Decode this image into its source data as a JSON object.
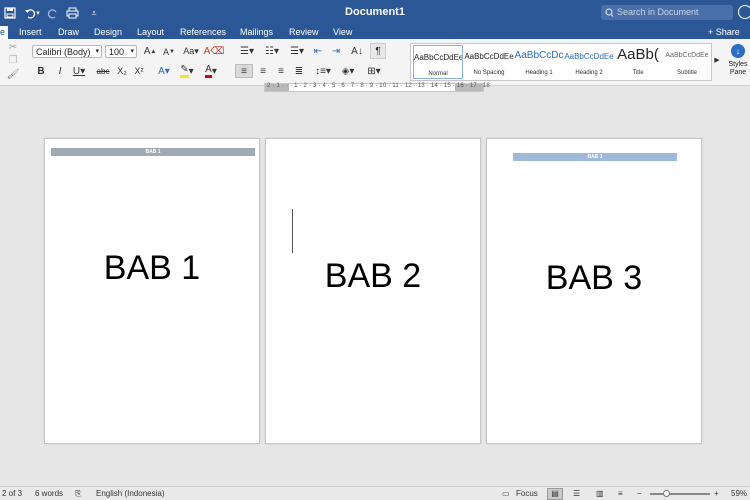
{
  "window": {
    "title": "Document1",
    "search_placeholder": "Search in Document"
  },
  "tabs": [
    {
      "label": "e"
    },
    {
      "label": "Insert"
    },
    {
      "label": "Draw"
    },
    {
      "label": "Design"
    },
    {
      "label": "Layout"
    },
    {
      "label": "References"
    },
    {
      "label": "Mailings"
    },
    {
      "label": "Review"
    },
    {
      "label": "View"
    }
  ],
  "share_label": "+ Share",
  "ribbon": {
    "font_name": "Calibri (Body)",
    "font_size": "100",
    "styles": [
      {
        "sample": "AaBbCcDdEe",
        "name": "Normal"
      },
      {
        "sample": "AaBbCcDdEe",
        "name": "No Spacing"
      },
      {
        "sample": "AaBbCcDc",
        "name": "Heading 1"
      },
      {
        "sample": "AaBbCcDdEe",
        "name": "Heading 2"
      },
      {
        "sample": "AaBb(",
        "name": "Title"
      },
      {
        "sample": "AaBbCcDdEe",
        "name": "Subtitle"
      }
    ],
    "styles_pane_label": "Styles Pane",
    "accent_color": "#2b5797"
  },
  "ruler": {
    "numbers": "2 · 1 · · · 1 · 2 · 3 · 4 · 5 · 6 · 7 · 8 · 9 · 10 · 11 · 12 · 13 · 14 · 15 · 16 · 17 · 18"
  },
  "pages": [
    {
      "header": "BAB 1",
      "body": "BAB 1"
    },
    {
      "header": "",
      "body": "BAB 2"
    },
    {
      "header": "BAB 1",
      "body": "BAB 3"
    }
  ],
  "status": {
    "page_info": "2 of 3",
    "word_count": "6 words",
    "language": "English (Indonesia)",
    "focus_label": "Focus",
    "zoom": "59%"
  }
}
